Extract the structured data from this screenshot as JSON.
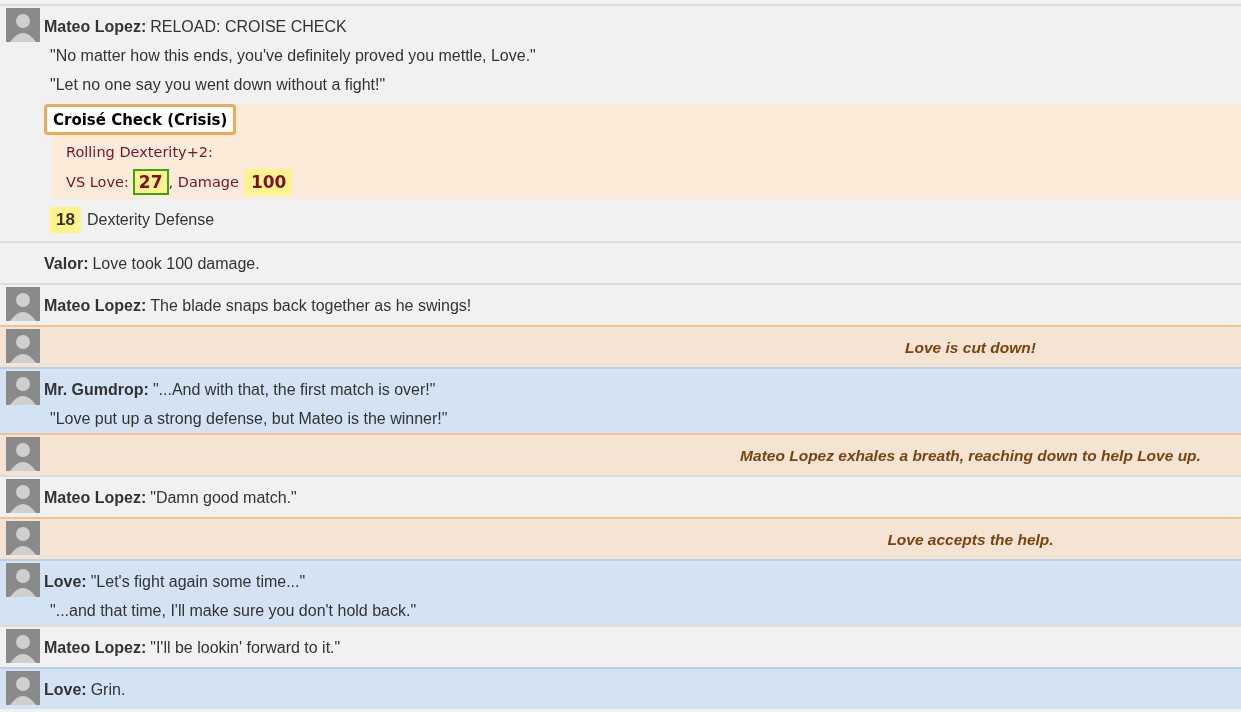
{
  "messages": [
    {
      "kind": "speech",
      "color": "#f1f1f1",
      "avatar": true,
      "speaker": "Mateo Lopez:",
      "lines": [
        "RELOAD: CROISE CHECK",
        "\"No matter how this ends, you've definitely proved you mettle, Love.\"",
        "\"Let no one say you went down without a fight!\""
      ],
      "check": {
        "title": "Croisé Check (Crisis)",
        "roll": "Rolling Dexterity+2:",
        "vs_label": "VS Love:",
        "vs_value": "27",
        "hit": true,
        "damage_label": ", Damage",
        "damage_value": "100"
      },
      "defense": {
        "value": "18",
        "label": "Dexterity Defense"
      }
    },
    {
      "kind": "speech",
      "color": "#f1f1f1",
      "avatar": false,
      "speaker": "Valor:",
      "lines": [
        "Love took 100 damage."
      ]
    },
    {
      "kind": "speech",
      "color": "#f1f1f1",
      "avatar": true,
      "speaker": "Mateo Lopez:",
      "lines": [
        "The blade snaps back together as he swings!"
      ]
    },
    {
      "kind": "action",
      "color": "#f5e3d3",
      "avatar": true,
      "lines": [
        "Love is cut down!"
      ]
    },
    {
      "kind": "speech",
      "color": "#d3e3f3",
      "avatar": true,
      "speaker": "Mr. Gumdrop:",
      "lines": [
        "\"...And with that, the first match is over!\"",
        "\"Love put up a strong defense, but Mateo is the winner!\""
      ]
    },
    {
      "kind": "action",
      "color": "#f5e3d3",
      "avatar": true,
      "lines": [
        "Mateo Lopez exhales a breath, reaching down to help Love up."
      ]
    },
    {
      "kind": "speech",
      "color": "#f1f1f1",
      "avatar": true,
      "speaker": "Mateo Lopez:",
      "lines": [
        "\"Damn good match.\""
      ]
    },
    {
      "kind": "action",
      "color": "#f5e3d3",
      "avatar": true,
      "lines": [
        "Love accepts the help."
      ]
    },
    {
      "kind": "speech",
      "color": "#d3e3f3",
      "avatar": true,
      "speaker": "Love:",
      "lines": [
        "\"Let's fight again some time...\"",
        "\"...and that time, I'll make sure you don't hold back.\""
      ]
    },
    {
      "kind": "speech",
      "color": "#f1f1f1",
      "avatar": true,
      "speaker": "Mateo Lopez:",
      "lines": [
        "\"I'll be lookin' forward to it.\""
      ]
    },
    {
      "kind": "speech",
      "color": "#d3e3f3",
      "avatar": true,
      "speaker": "Love:",
      "lines": [
        "Grin."
      ]
    }
  ]
}
